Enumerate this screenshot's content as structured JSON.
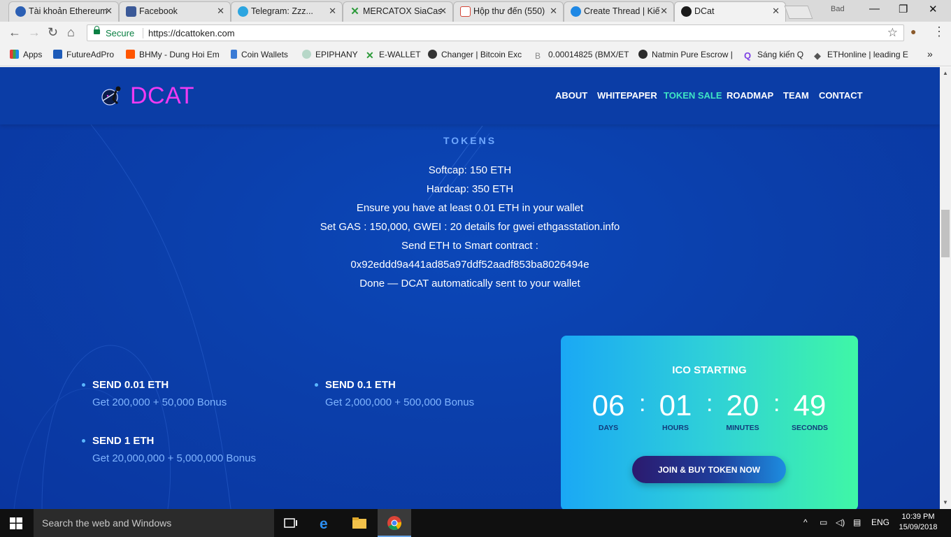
{
  "browser": {
    "tabs": [
      {
        "title": "Tài khoản Ethereum",
        "active": false
      },
      {
        "title": "Facebook",
        "active": false
      },
      {
        "title": "Telegram: Zzz...",
        "active": false
      },
      {
        "title": "MERCATOX SiaCas",
        "active": false
      },
      {
        "title": "Hộp thư đến (550)",
        "active": false
      },
      {
        "title": "Create Thread | Kiế",
        "active": false
      },
      {
        "title": "DCat",
        "active": true
      }
    ],
    "profile_label": "Bad",
    "secure_label": "Secure",
    "url": "https://dcattoken.com",
    "bookmarks": [
      "Apps",
      "FutureAdPro",
      "BHMy - Dung Hoi Em",
      "Coin Wallets",
      "EPIPHANY",
      "E-WALLET",
      "Changer | Bitcoin Exc",
      "0.00014825 (BMX/ET",
      "Natmin Pure Escrow |",
      "Sáng kiến Q",
      "ETHonline | leading E"
    ]
  },
  "site": {
    "logo": "DCAT",
    "nav": [
      "ABOUT",
      "WHITEPAPER",
      "TOKEN SALE",
      "ROADMAP",
      "TEAM",
      "CONTACT"
    ],
    "active_nav": "TOKEN SALE",
    "tokens_title": "TOKENS",
    "tokens_info": [
      "Softcap: 150 ETH",
      "Hardcap: 350 ETH",
      "Ensure you have at least 0.01 ETH in your wallet",
      "Set GAS : 150,000, GWEI : 20 details for gwei ethgasstation.info",
      "Send ETH to Smart contract :",
      "0x92eddd9a441ad85a97ddf52aadf853ba8026494e",
      "Done — DCAT automatically sent to your wallet"
    ],
    "offers": [
      {
        "title": "SEND 0.01 ETH",
        "bonus": "Get 200,000 + 50,000 Bonus"
      },
      {
        "title": "SEND 0.1 ETH",
        "bonus": "Get 2,000,000 + 500,000 Bonus"
      },
      {
        "title": "SEND 1 ETH",
        "bonus": "Get 20,000,000 + 5,000,000 Bonus"
      }
    ],
    "countdown": {
      "title": "ICO STARTING",
      "days": "06",
      "hours": "01",
      "minutes": "20",
      "seconds": "49",
      "days_label": "DAYS",
      "hours_label": "HOURS",
      "minutes_label": "MINUTES",
      "seconds_label": "SECONDS",
      "button": "JOIN & BUY TOKEN NOW"
    },
    "colors": {
      "background": "#0b3fab",
      "logo": "#f03bf2",
      "active_nav": "#3ee6c4",
      "card_start": "#1aa8f5",
      "card_end": "#3ff7a6"
    }
  },
  "taskbar": {
    "search_placeholder": "Search the web and Windows",
    "language": "ENG",
    "time": "10:39 PM",
    "date": "15/09/2018"
  }
}
